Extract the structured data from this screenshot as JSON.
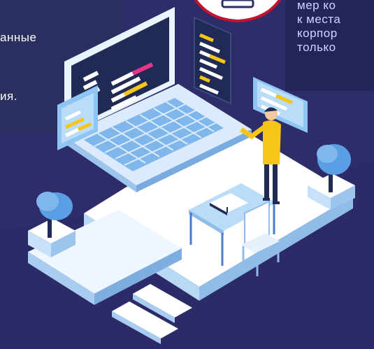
{
  "left_text": {
    "line1": "анные",
    "line2": "ия."
  },
  "right_text": {
    "lines": [
      "мер ко",
      "к места",
      "корпор",
      "только"
    ]
  },
  "colors": {
    "background": "#2b2a63",
    "panel_dark": "#2a2f60",
    "accent_yellow": "#f5c518",
    "accent_pink": "#e8358a",
    "accent_red": "#c4122f",
    "platform_light": "#e8f3ff",
    "screen_light": "#8ec5f2"
  },
  "icons": [
    "laptop-illustration",
    "person-figure",
    "open-book-icon",
    "tree-icon",
    "chair-icon",
    "code-panel-icon"
  ]
}
